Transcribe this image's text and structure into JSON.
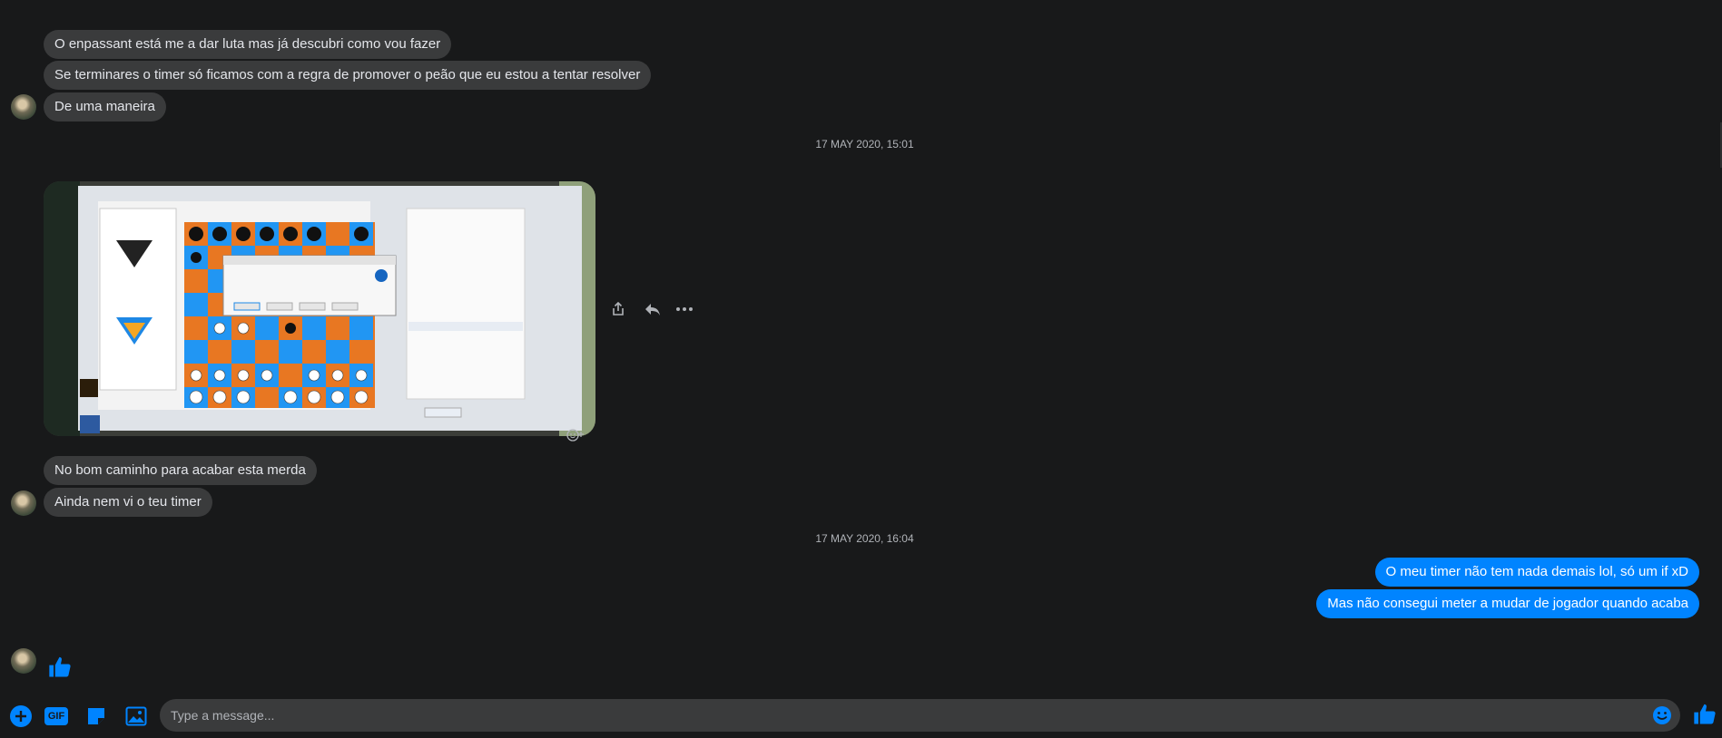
{
  "messages_top": [
    {
      "text": "O enpassant está me a dar luta mas já descubri como vou fazer"
    },
    {
      "text": "Se terminares o timer só ficamos com a regra de promover o peão que eu estou a tentar resolver"
    },
    {
      "text": "De uma maneira"
    }
  ],
  "timestamp_1": "17 MAY 2020, 15:01",
  "photo_actions": {
    "share_icon": "share-icon",
    "reply_icon": "reply-icon",
    "more_icon": "more-icon"
  },
  "messages_mid": [
    {
      "text": "No bom caminho para acabar esta merda"
    },
    {
      "text": "Ainda nem vi o teu timer"
    }
  ],
  "timestamp_2": "17 MAY 2020, 16:04",
  "messages_out": [
    {
      "text": "O meu timer não tem nada demais lol, só um if xD"
    },
    {
      "text": "Mas não consegui meter a mudar de jogador quando acaba"
    }
  ],
  "composer": {
    "placeholder": "Type a message...",
    "gif_label": "GIF"
  },
  "colors": {
    "accent": "#0084ff",
    "bubble_in": "#3a3b3c",
    "background": "#18191a"
  }
}
